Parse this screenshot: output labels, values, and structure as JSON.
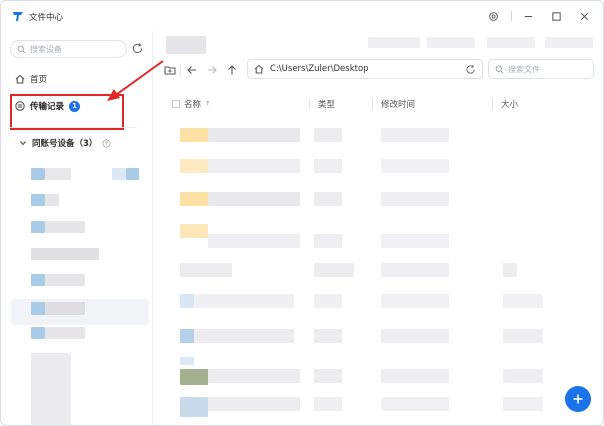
{
  "app": {
    "title": "文件中心"
  },
  "sidebar": {
    "search_placeholder": "搜索设备",
    "nav": [
      {
        "label": "首页",
        "icon": "home-icon"
      },
      {
        "label": "传输记录",
        "icon": "transfer-icon",
        "badge": "1"
      }
    ],
    "group": {
      "label": "同账号设备（3）",
      "help_icon": "help-icon"
    }
  },
  "toolbar": {
    "path": "C:\\Users\\Zuler\\Desktop",
    "search_placeholder": "搜索文件"
  },
  "table": {
    "columns": [
      "名称",
      "类型",
      "修改时间",
      "大小"
    ],
    "sort_indicator": "↑"
  },
  "colors": {
    "accent": "#1a73e8",
    "annotation": "#e32626"
  }
}
